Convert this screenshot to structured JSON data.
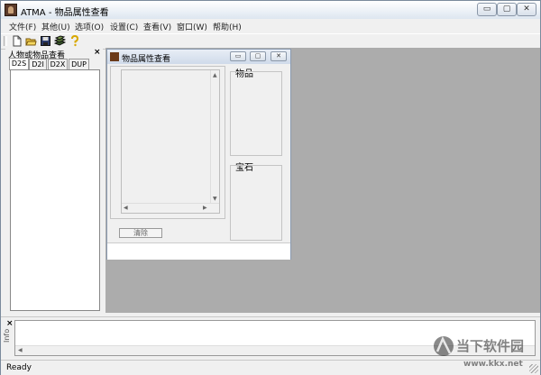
{
  "window": {
    "title": "ATMA - 物品属性查看",
    "minimize": "▭",
    "maximize": "▢",
    "close": "✕"
  },
  "menu": [
    "文件(F)",
    "其他(U)",
    "选项(O)",
    "设置(C)",
    "查看(V)",
    "窗口(W)",
    "帮助(H)"
  ],
  "toolbar": {
    "icons": [
      "new-file-icon",
      "open-folder-icon",
      "save-icon",
      "stack-icon",
      "help-icon"
    ]
  },
  "sidepanel": {
    "title": "人物或物品查看",
    "close": "×",
    "tabs": [
      "D2S",
      "D2I",
      "D2X",
      "DUP"
    ],
    "active_tab": "D2S"
  },
  "child": {
    "title": "物品属性查看",
    "minimize": "▭",
    "maximize": "▢",
    "close": "✕",
    "items_label": "物品",
    "gems_label": "宝石",
    "clear_button": "清除"
  },
  "info": {
    "label": "Info",
    "close": "×"
  },
  "status": {
    "text": "Ready"
  },
  "watermark": {
    "text": "当下软件园",
    "url": "www.kkx.net"
  },
  "colors": {
    "mdi_background": "#acacac",
    "chrome": "#f0f0f0",
    "title_gradient_top": "#ffffff",
    "title_gradient_bottom": "#dde6f0"
  }
}
